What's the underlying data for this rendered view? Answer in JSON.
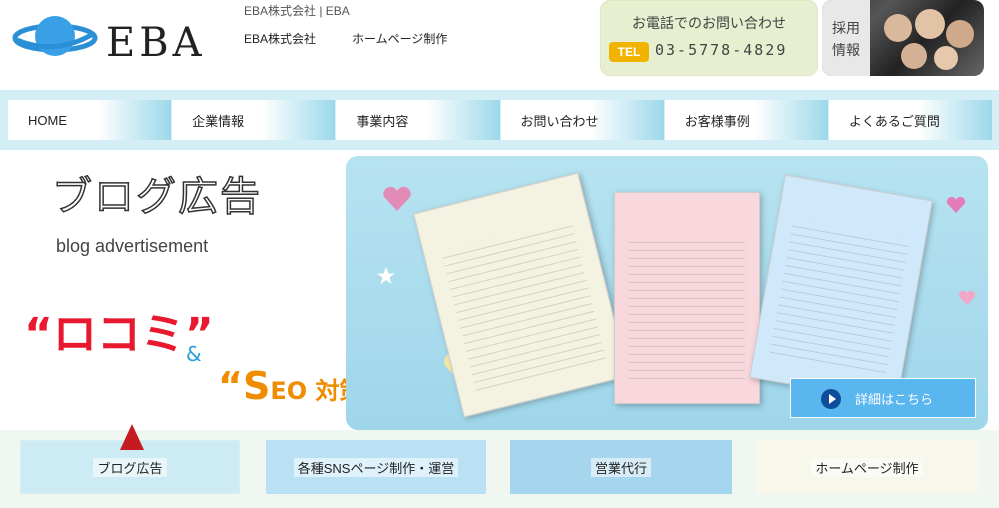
{
  "header": {
    "company_tag": "EBA株式会社 | EBA",
    "logo_text": "EBA",
    "links": [
      "EBA株式会社",
      "ホームページ制作"
    ],
    "contact": {
      "title": "お電話でのお問い合わせ",
      "tel_label": "TEL",
      "tel_number": "03-5778-4829"
    },
    "recruit_label": [
      "採用",
      "情報"
    ]
  },
  "nav": {
    "items": [
      "HOME",
      "企業情報",
      "事業内容",
      "お問い合わせ",
      "お客様事例",
      "よくあるご質問"
    ]
  },
  "hero": {
    "title": "ブログ広告",
    "subtitle": "blog advertisement",
    "kuchikomi": "“ロコミ”",
    "amp": "&",
    "seo_s": "“S",
    "seo_rest": "EO 対策”",
    "detail_button": "詳細はこちら"
  },
  "services": {
    "tiles": [
      "ブログ広告",
      "各種SNSページ制作・運営",
      "営業代行",
      "ホームページ制作"
    ]
  },
  "colors": {
    "nav_accent": "#9cd8ea",
    "tel_badge": "#f0b400",
    "kuchikomi": "#e8182f",
    "seo": "#f08c00",
    "detail_button": "#5ab6ee",
    "arrow": "#c41a20"
  }
}
